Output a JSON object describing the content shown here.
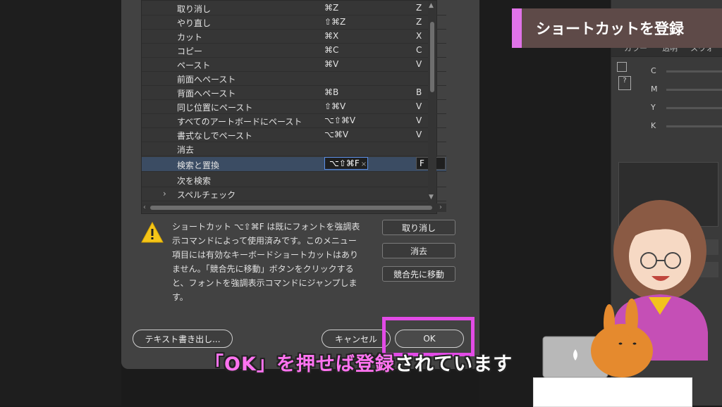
{
  "shortcut_table": {
    "rows": [
      {
        "name": "取り消し",
        "shortcut": "⌘Z",
        "alt": "Z"
      },
      {
        "name": "やり直し",
        "shortcut": "⇧⌘Z",
        "alt": "Z"
      },
      {
        "name": "カット",
        "shortcut": "⌘X",
        "alt": "X"
      },
      {
        "name": "コピー",
        "shortcut": "⌘C",
        "alt": "C"
      },
      {
        "name": "ペースト",
        "shortcut": "⌘V",
        "alt": "V"
      },
      {
        "name": "前面へペースト",
        "shortcut": "",
        "alt": ""
      },
      {
        "name": "背面へペースト",
        "shortcut": "⌘B",
        "alt": "B"
      },
      {
        "name": "同じ位置にペースト",
        "shortcut": "⇧⌘V",
        "alt": "V"
      },
      {
        "name": "すべてのアートボードにペースト",
        "shortcut": "⌥⇧⌘V",
        "alt": "V"
      },
      {
        "name": "書式なしでペースト",
        "shortcut": "⌥⌘V",
        "alt": "V"
      },
      {
        "name": "消去",
        "shortcut": "",
        "alt": ""
      },
      {
        "name": "検索と置換",
        "shortcut": "⌥⇧⌘F",
        "alt": "F"
      },
      {
        "name": "次を検索",
        "shortcut": "",
        "alt": ""
      },
      {
        "name": "スペルチェック",
        "shortcut": "",
        "alt": ""
      }
    ]
  },
  "warning": {
    "text": "ショートカット ⌥⇧⌘F は既にフォントを強調表示コマンドによって使用済みです。このメニュー項目には有効なキーボードショートカットはありません。「競合先に移動」ボタンをクリックすると、フォントを強調表示コマンドにジャンプします。",
    "undo_label": "取り消し",
    "clear_label": "消去",
    "goto_conflict_label": "競合先に移動"
  },
  "footer": {
    "export_label": "テキスト書き出し...",
    "cancel_label": "キャンセル",
    "ok_label": "OK"
  },
  "title_card": "ショートカットを登録",
  "subtitle": {
    "part1": "「OK」を押せば",
    "part2": "登録",
    "part3": "されています"
  },
  "right_panel": {
    "tab1": "カラー",
    "tab2": "透明",
    "tab3": "スウォ",
    "sliders": [
      "C",
      "M",
      "Y",
      "K"
    ]
  },
  "colors": {
    "accent_pink": "#e24be6",
    "selected_row": "#3b4c63",
    "title_bg": "#5e4a48"
  }
}
